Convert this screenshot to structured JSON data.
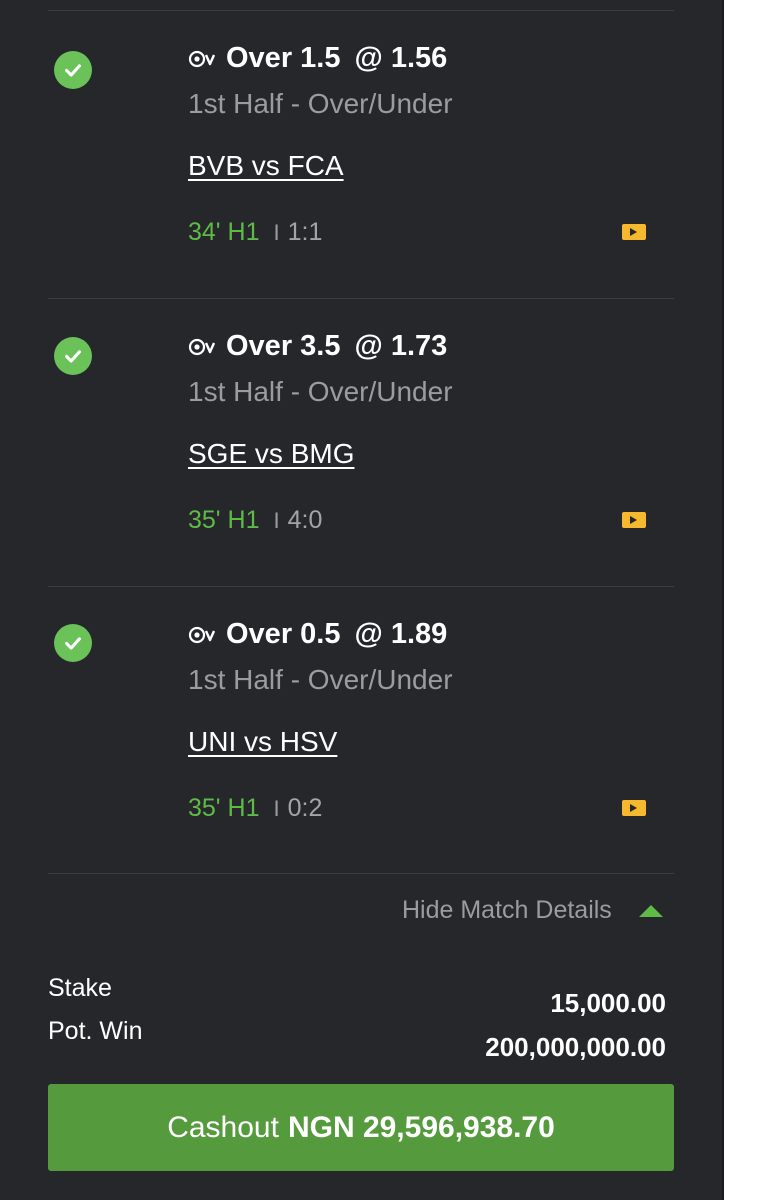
{
  "bets": [
    {
      "selection": "Over 1.5",
      "odd": "@ 1.56",
      "market": "1st Half - Over/Under",
      "match": "BVB vs FCA",
      "time": "34' H1",
      "score": "1:1"
    },
    {
      "selection": "Over 3.5",
      "odd": "@ 1.73",
      "market": "1st Half - Over/Under",
      "match": "SGE vs BMG",
      "time": "35' H1",
      "score": "4:0"
    },
    {
      "selection": "Over 0.5",
      "odd": "@ 1.89",
      "market": "1st Half - Over/Under",
      "match": "UNI vs HSV",
      "time": "35' H1",
      "score": "0:2"
    }
  ],
  "separator": "I",
  "toggle_label": "Hide Match Details",
  "summary": {
    "stake_label": "Stake",
    "stake_value": "15,000.00",
    "potwin_label": "Pot. Win",
    "potwin_value": "200,000,000.00"
  },
  "cashout": {
    "label": "Cashout",
    "amount": "NGN 29,596,938.70"
  },
  "icons": {
    "status": "check-circle-icon",
    "sport": "soccer-ball-icon",
    "live_stream": "live-tv-icon",
    "toggle": "triangle-up-icon"
  },
  "colors": {
    "panel": "#26272b",
    "success": "#6ac259",
    "live": "#5dbb46",
    "cashout_button": "#569a3e",
    "stream_icon": "#f5b82e",
    "muted_text": "#9b9ca1"
  }
}
